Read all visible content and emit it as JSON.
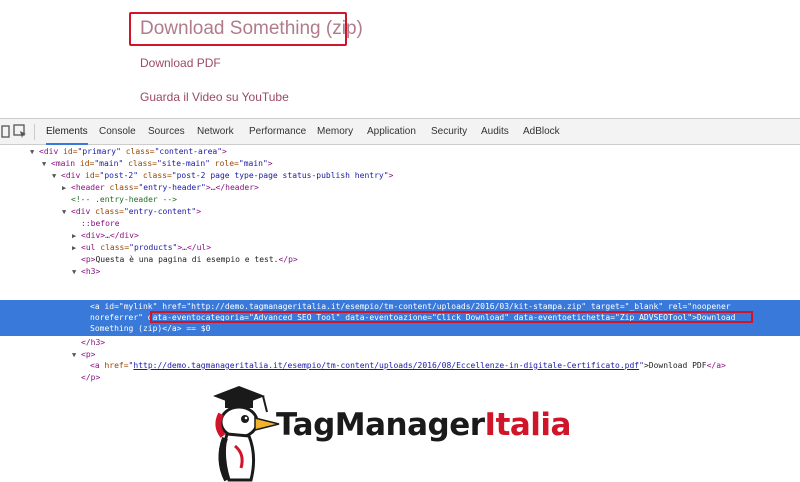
{
  "page": {
    "links": {
      "download_zip": "Download Something (zip)",
      "download_pdf": "Download PDF",
      "video": "Guarda il Video su YouTube"
    }
  },
  "devtools": {
    "tabs": [
      "Elements",
      "Console",
      "Sources",
      "Network",
      "Performance",
      "Memory",
      "Application",
      "Security",
      "Audits",
      "AdBlock"
    ],
    "active_tab": "Elements",
    "lines": {
      "l1": {
        "tag": "<div",
        "attr1": " id=",
        "val1": "\"primary\"",
        "attr2": " class=",
        "val2": "\"content-area\"",
        "end": ">"
      },
      "l2": {
        "tag": "<main",
        "attr1": " id=",
        "val1": "\"main\"",
        "attr2": " class=",
        "val2": "\"site-main\"",
        "attr3": " role=",
        "val3": "\"main\"",
        "end": ">"
      },
      "l3": {
        "tag": "<div",
        "attr1": " id=",
        "val1": "\"post-2\"",
        "attr2": " class=",
        "val2": "\"post-2 page type-page status-publish hentry\"",
        "end": ">"
      },
      "l4": {
        "tag": "<header",
        "attr1": " class=",
        "val1": "\"entry-header\"",
        "end": ">…</header>"
      },
      "l5": {
        "comment": "<!-- .entry-header -->"
      },
      "l6": {
        "tag": "<div",
        "attr1": " class=",
        "val1": "\"entry-content\"",
        "end": ">"
      },
      "l7": {
        "pseudo": "::before"
      },
      "l8": {
        "text": "<div>…</div>"
      },
      "l9": {
        "tag": "<ul",
        "attr1": " class=",
        "val1": "\"products\"",
        "end": ">…</ul>"
      },
      "l10": {
        "open": "<p>",
        "text": "Questa è una pagina di esempio e test.",
        "close": "</p>"
      },
      "l11": {
        "text": "<h3>"
      },
      "l12": {
        "tag": "<a",
        "attr1": " id=",
        "val1": "\"mylink\"",
        "attr2": " href=",
        "val2": "\"http://demo.tagmanageritalia.it/esempio/tm-content/uploads/2016/03/kit-stampa.zip\"",
        "attr3": " target=",
        "val3": "\"_blank\"",
        "attr4": " rel=",
        "val4": "\"noopener"
      },
      "l13": {
        "val": "noreferrer\"",
        "attr1": " data-eventocategoria=",
        "val1": "\"Advanced SEO Tool\"",
        "attr2": " data-eventoazione=",
        "val2": "\"Click Download\"",
        "attr3": " data-eventoetichetta=",
        "val3": "\"Zip ADVSEOTool\"",
        "text": ">Download"
      },
      "l14": {
        "text": "Something (zip)",
        "close": "</a>",
        "eq": " == $0"
      },
      "l15": {
        "text": "</h3>"
      },
      "l16": {
        "text": "<p>"
      },
      "l17": {
        "tag": "<a",
        "attr1": " href=",
        "url": "http://demo.tagmanageritalia.it/esempio/tm-content/uploads/2016/08/Eccellenze-in-digitale-Certificato.pdf",
        "q2": "\"",
        "text": ">Download PDF",
        "close": "</a>"
      },
      "l18": {
        "text": "</p>"
      }
    }
  },
  "brand": {
    "part1": "TagManager",
    "part2": "Italia"
  },
  "colors": {
    "accent_red": "#d0152b",
    "selection_blue": "#3879d9",
    "link_color": "#9a4a66"
  }
}
